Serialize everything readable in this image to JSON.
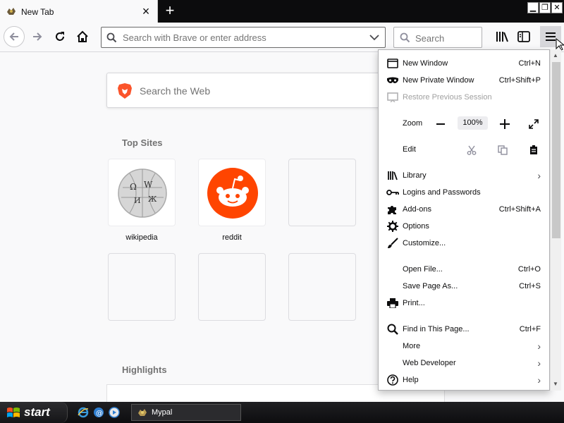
{
  "tab": {
    "title": "New Tab"
  },
  "navbar": {
    "url_placeholder": "Search with Brave or enter address",
    "search_placeholder": "Search"
  },
  "content": {
    "web_search": "Search the Web",
    "top_sites_title": "Top Sites",
    "top_sites": [
      {
        "label": "wikipedia",
        "icon": "wikipedia-globe"
      },
      {
        "label": "reddit",
        "icon": "reddit-alien"
      }
    ],
    "highlights_title": "Highlights"
  },
  "menu": {
    "new_window": {
      "label": "New Window",
      "shortcut": "Ctrl+N"
    },
    "new_private": {
      "label": "New Private Window",
      "shortcut": "Ctrl+Shift+P"
    },
    "restore": {
      "label": "Restore Previous Session"
    },
    "zoom": {
      "label": "Zoom",
      "value": "100%"
    },
    "edit": {
      "label": "Edit"
    },
    "library": {
      "label": "Library"
    },
    "logins": {
      "label": "Logins and Passwords"
    },
    "addons": {
      "label": "Add-ons",
      "shortcut": "Ctrl+Shift+A"
    },
    "options": {
      "label": "Options"
    },
    "customize": {
      "label": "Customize..."
    },
    "open_file": {
      "label": "Open File...",
      "shortcut": "Ctrl+O"
    },
    "save_page": {
      "label": "Save Page As...",
      "shortcut": "Ctrl+S"
    },
    "print": {
      "label": "Print..."
    },
    "find": {
      "label": "Find in This Page...",
      "shortcut": "Ctrl+F"
    },
    "more": {
      "label": "More"
    },
    "web_dev": {
      "label": "Web Developer"
    },
    "help": {
      "label": "Help"
    }
  },
  "taskbar": {
    "start_label": "start",
    "task_label": "Mypal"
  },
  "colors": {
    "accent": "#fb542b",
    "reddit": "#ff4500",
    "taskbar": "#141416"
  }
}
